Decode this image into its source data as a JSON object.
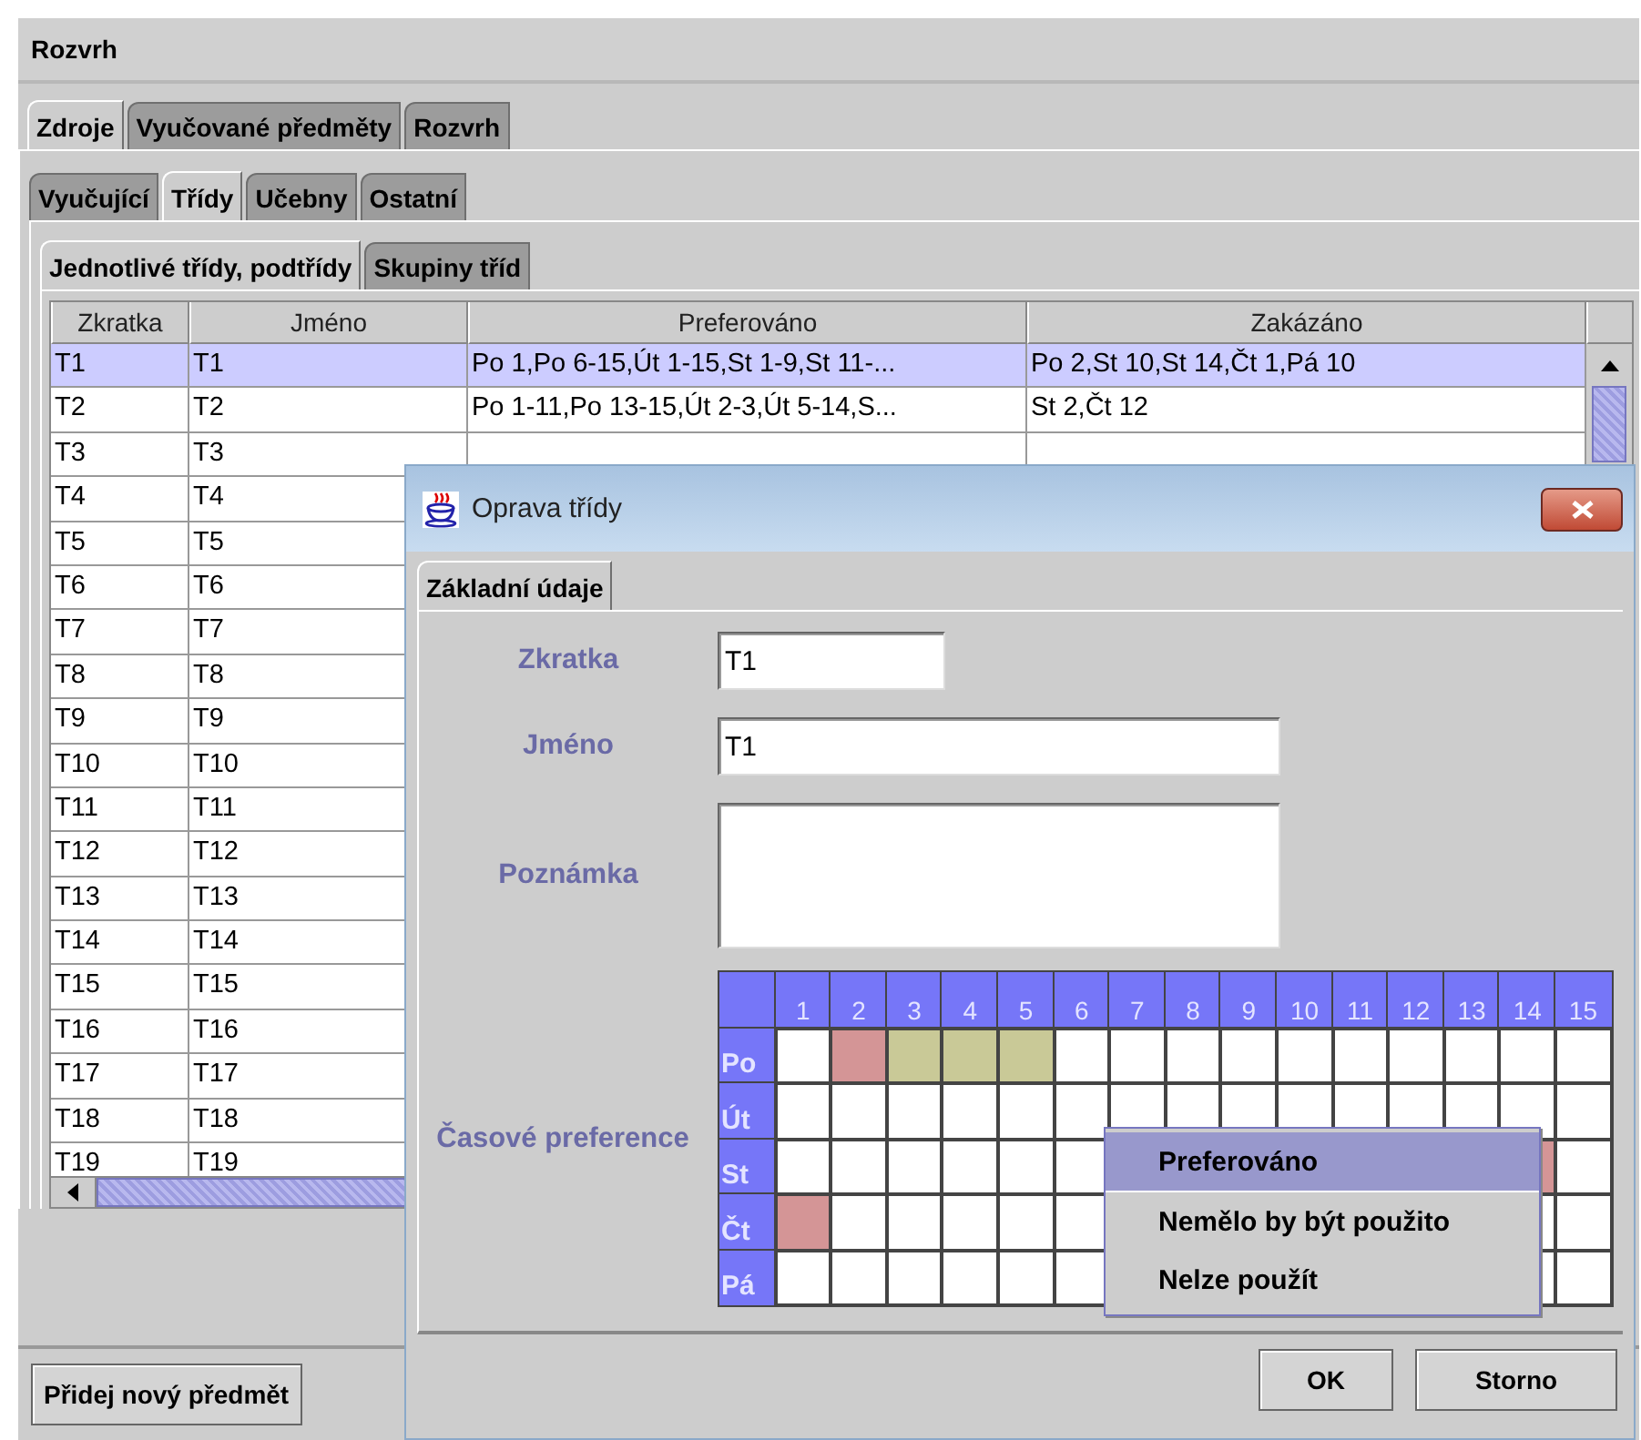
{
  "window": {
    "title": "Rozvrh"
  },
  "tabs": [
    {
      "label": "Zdroje",
      "selected": true
    },
    {
      "label": "Vyučované předměty",
      "selected": false
    },
    {
      "label": "Rozvrh",
      "selected": false
    }
  ],
  "subtabs": [
    {
      "label": "Vyučující",
      "selected": false
    },
    {
      "label": "Třídy",
      "selected": true
    },
    {
      "label": "Učebny",
      "selected": false
    },
    {
      "label": "Ostatní",
      "selected": false
    }
  ],
  "class_tabs": [
    {
      "label": "Jednotlivé třídy, podtřídy",
      "selected": true
    },
    {
      "label": "Skupiny tříd",
      "selected": false
    }
  ],
  "table": {
    "columns": [
      "Zkratka",
      "Jméno",
      "Preferováno",
      "Zakázáno"
    ],
    "rows": [
      {
        "zkratka": "T1",
        "jmeno": "T1",
        "preferovano": "Po 1,Po 6-15,Út 1-15,St 1-9,St 11-...",
        "zakazano": "Po 2,St 10,St 14,Čt 1,Pá 10",
        "selected": true
      },
      {
        "zkratka": "T2",
        "jmeno": "T2",
        "preferovano": "Po 1-11,Po 13-15,Út 2-3,Út 5-14,S...",
        "zakazano": "St 2,Čt 12",
        "selected": false
      },
      {
        "zkratka": "T3",
        "jmeno": "T3",
        "selected": false
      },
      {
        "zkratka": "T4",
        "jmeno": "T4",
        "selected": false
      },
      {
        "zkratka": "T5",
        "jmeno": "T5",
        "selected": false
      },
      {
        "zkratka": "T6",
        "jmeno": "T6",
        "selected": false
      },
      {
        "zkratka": "T7",
        "jmeno": "T7",
        "selected": false
      },
      {
        "zkratka": "T8",
        "jmeno": "T8",
        "selected": false
      },
      {
        "zkratka": "T9",
        "jmeno": "T9",
        "selected": false
      },
      {
        "zkratka": "T10",
        "jmeno": "T10",
        "selected": false
      },
      {
        "zkratka": "T11",
        "jmeno": "T11",
        "selected": false
      },
      {
        "zkratka": "T12",
        "jmeno": "T12",
        "selected": false
      },
      {
        "zkratka": "T13",
        "jmeno": "T13",
        "selected": false
      },
      {
        "zkratka": "T14",
        "jmeno": "T14",
        "selected": false
      },
      {
        "zkratka": "T15",
        "jmeno": "T15",
        "selected": false
      },
      {
        "zkratka": "T16",
        "jmeno": "T16",
        "selected": false
      },
      {
        "zkratka": "T17",
        "jmeno": "T17",
        "selected": false
      },
      {
        "zkratka": "T18",
        "jmeno": "T18",
        "selected": false
      },
      {
        "zkratka": "T19",
        "jmeno": "T19",
        "selected": false
      }
    ]
  },
  "bottom_buttons": [
    "Přidej nový předmět"
  ],
  "dialog": {
    "title": "Oprava třídy",
    "tabs": [
      {
        "label": "Základní údaje",
        "selected": true
      }
    ],
    "fields": [
      {
        "label": "Zkratka",
        "value": "T1",
        "kind": "short"
      },
      {
        "label": "Jméno",
        "value": "T1",
        "kind": "long"
      },
      {
        "label": "Poznámka",
        "kind": "area"
      }
    ],
    "time_preferences": {
      "label": "Časové preference",
      "columns": [
        "1",
        "2",
        "3",
        "4",
        "5",
        "6",
        "7",
        "8",
        "9",
        "10",
        "11",
        "12",
        "13",
        "14",
        "15"
      ],
      "rows": [
        {
          "day": "Po",
          "cells": [
            {
              "color": "#ffffff"
            },
            {
              "color": "#d49596"
            },
            {
              "color": "#c9c997"
            },
            {
              "color": "#c9c997"
            },
            {
              "color": "#c9c997"
            },
            {
              "color": "#ffffff"
            },
            {
              "color": "#ffffff"
            },
            {
              "color": "#ffffff"
            },
            {
              "color": "#ffffff"
            },
            {
              "color": "#ffffff"
            },
            {
              "color": "#ffffff"
            },
            {
              "color": "#ffffff"
            },
            {
              "color": "#ffffff"
            },
            {
              "color": "#ffffff"
            },
            {
              "color": "#ffffff"
            }
          ]
        },
        {
          "day": "Út",
          "cells": [
            {
              "color": "#ffffff"
            },
            {
              "color": "#ffffff"
            },
            {
              "color": "#ffffff"
            },
            {
              "color": "#ffffff"
            },
            {
              "color": "#ffffff"
            },
            {
              "color": "#ffffff"
            },
            {
              "color": "#ffffff"
            },
            {
              "color": "#ffffff"
            },
            {
              "color": "#ffffff"
            },
            {
              "color": "#ffffff"
            },
            {
              "color": "#ffffff"
            },
            {
              "color": "#ffffff"
            },
            {
              "color": "#ffffff"
            },
            {
              "color": "#ffffff"
            },
            {
              "color": "#ffffff"
            }
          ]
        },
        {
          "day": "St",
          "cells": [
            {
              "color": "#ffffff"
            },
            {
              "color": "#ffffff"
            },
            {
              "color": "#ffffff"
            },
            {
              "color": "#ffffff"
            },
            {
              "color": "#ffffff"
            },
            {
              "color": "#ffffff"
            },
            null,
            null,
            null,
            null,
            null,
            null,
            null,
            {
              "color": "#d49596"
            },
            {
              "color": "#ffffff"
            }
          ]
        },
        {
          "day": "Čt",
          "cells": [
            {
              "color": "#d49596"
            },
            {
              "color": "#ffffff"
            },
            {
              "color": "#ffffff"
            },
            {
              "color": "#ffffff"
            },
            {
              "color": "#ffffff"
            },
            {
              "color": "#ffffff"
            },
            null,
            null,
            null,
            null,
            null,
            null,
            null,
            {
              "color": "#ffffff"
            },
            {
              "color": "#ffffff"
            }
          ]
        },
        {
          "day": "Pá",
          "cells": [
            {
              "color": "#ffffff"
            },
            {
              "color": "#ffffff"
            },
            {
              "color": "#ffffff"
            },
            {
              "color": "#ffffff"
            },
            {
              "color": "#ffffff"
            },
            {
              "color": "#ffffff"
            },
            null,
            null,
            null,
            null,
            null,
            null,
            null,
            {
              "color": "#ffffff"
            },
            {
              "color": "#ffffff"
            }
          ]
        }
      ]
    },
    "context_menu": [
      {
        "label": "Preferováno",
        "selected": true
      },
      {
        "label": "Nemělo by být použito",
        "selected": false
      },
      {
        "label": "Nelze použít",
        "selected": false
      }
    ],
    "buttons": [
      "OK",
      "Storno"
    ]
  }
}
